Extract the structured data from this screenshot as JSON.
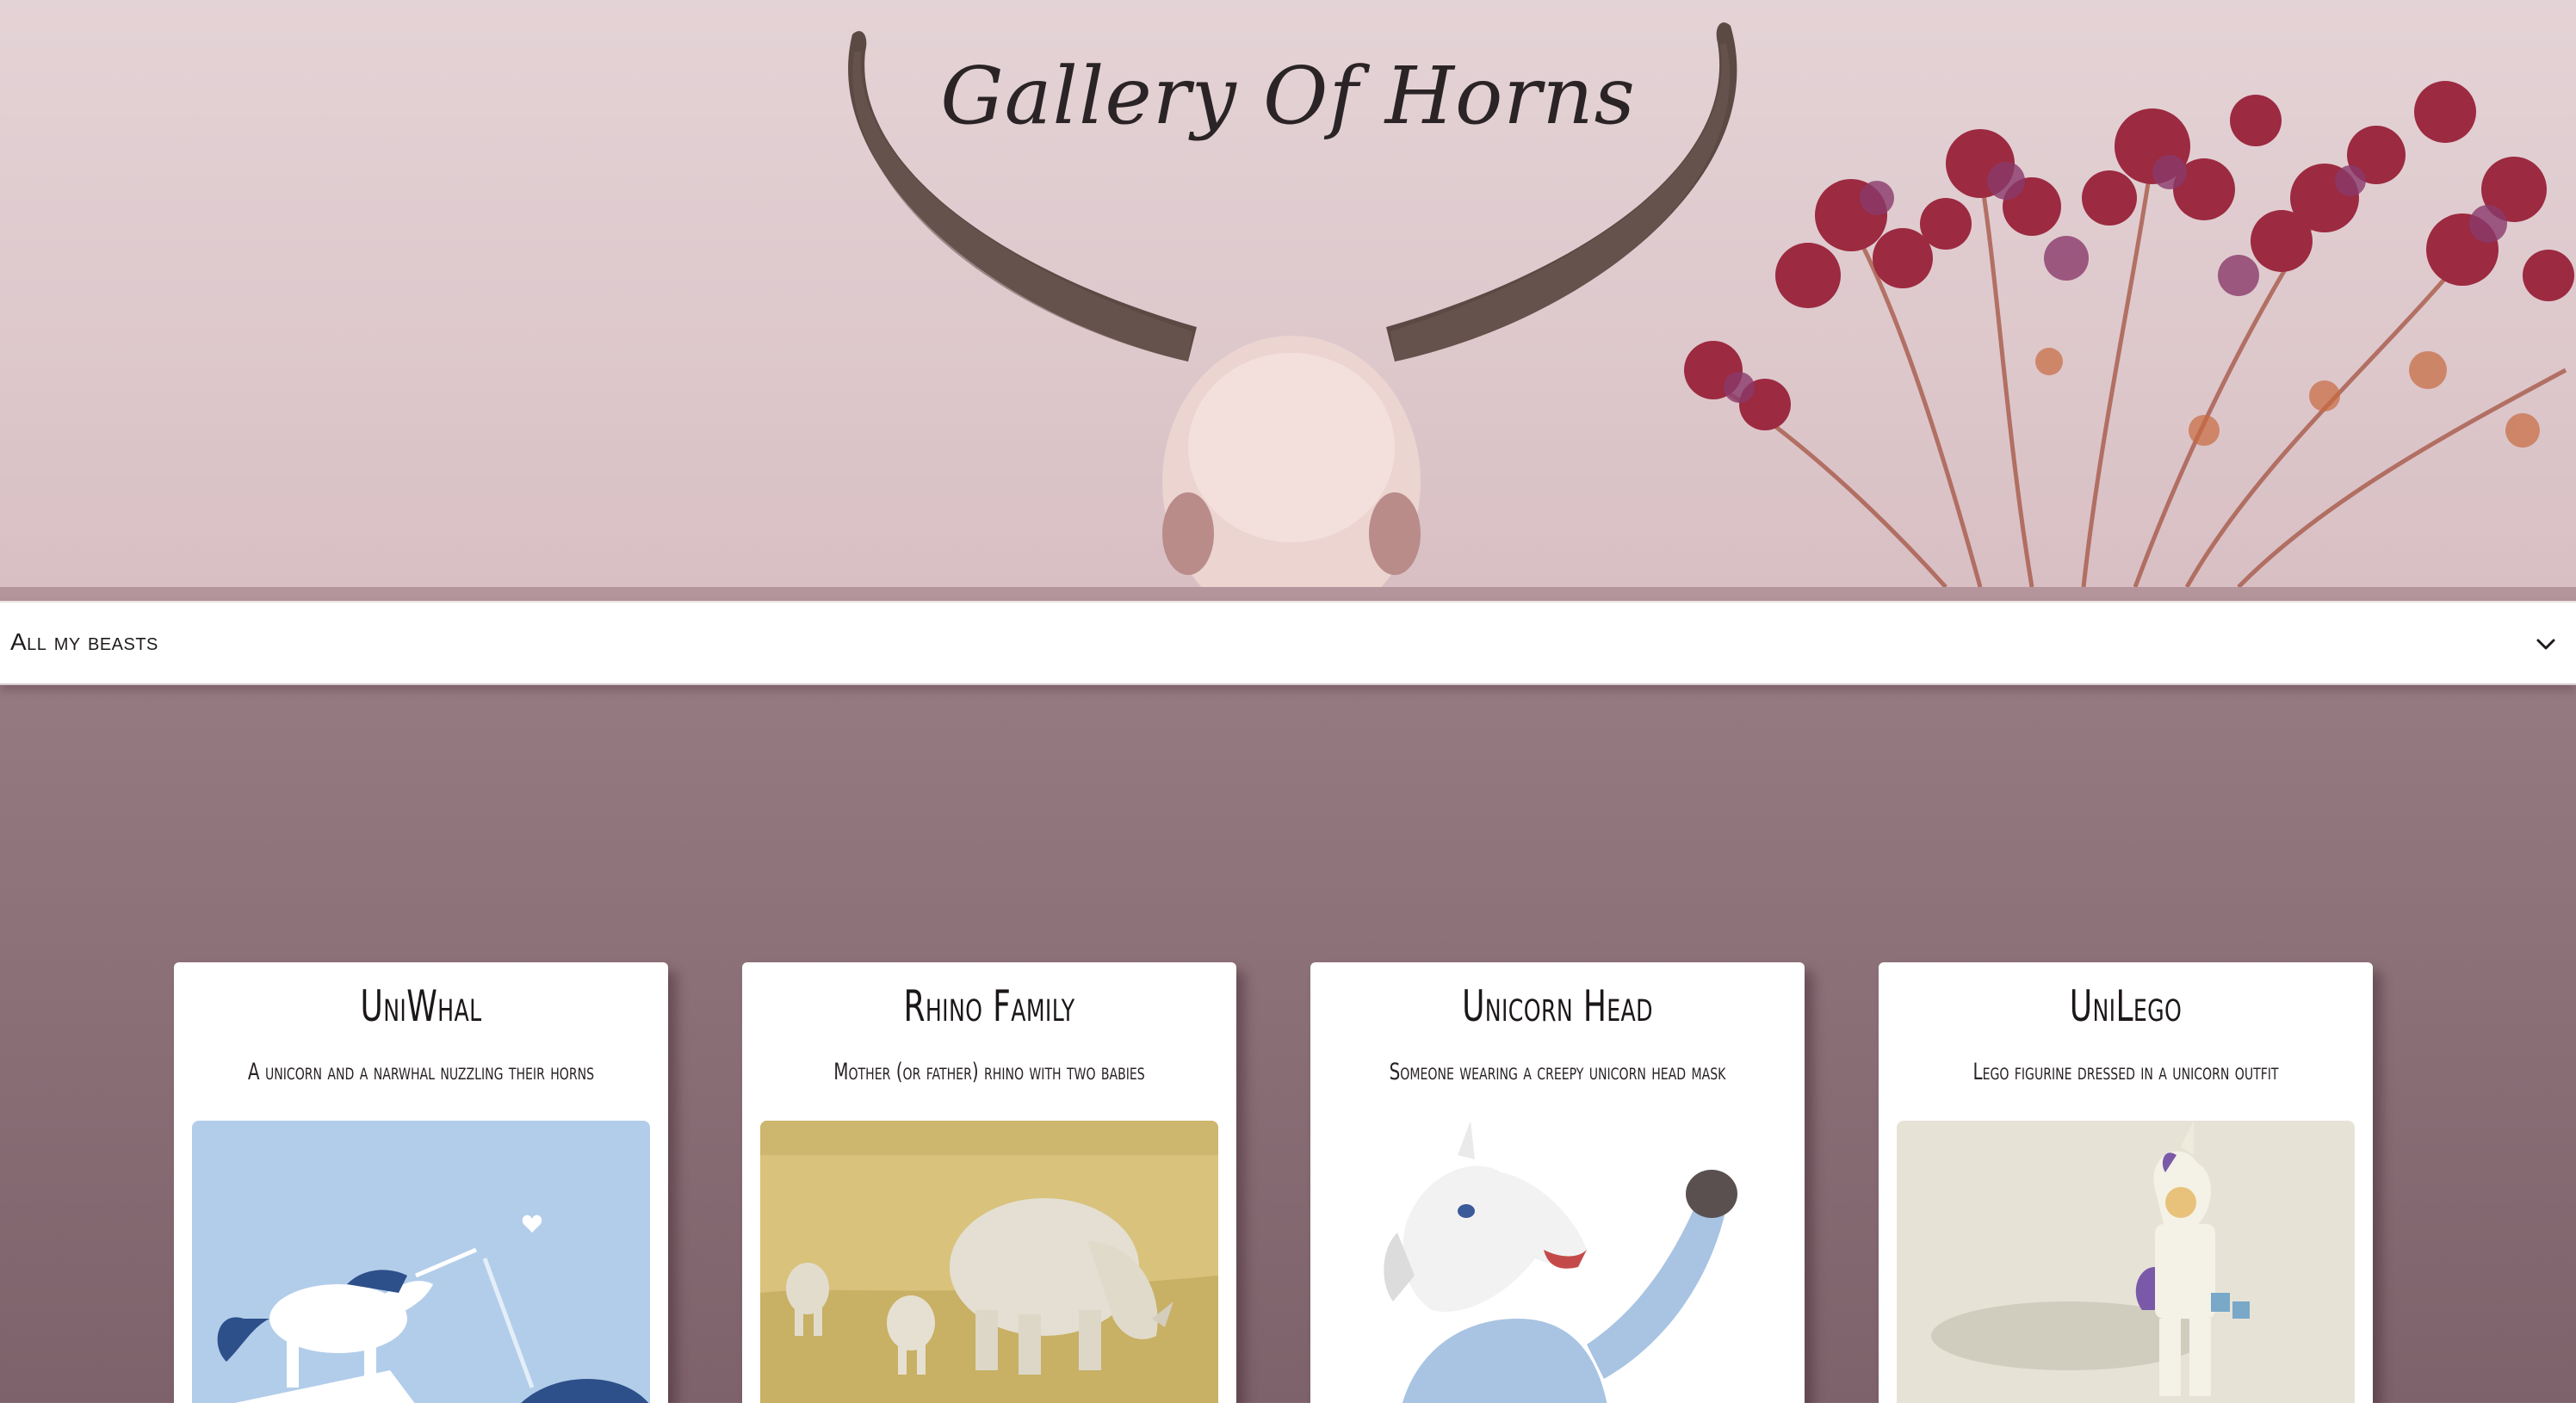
{
  "header": {
    "title": "Gallery Of Horns"
  },
  "filter": {
    "selected": "All my beasts"
  },
  "cards": [
    {
      "title": "UniWhal",
      "description": "A unicorn and a narwhal nuzzling their horns"
    },
    {
      "title": "Rhino Family",
      "description": "Mother (or father) rhino with two babies"
    },
    {
      "title": "Unicorn Head",
      "description": "Someone wearing a creepy unicorn head mask"
    },
    {
      "title": "UniLego",
      "description": "Lego figurine dressed in a unicorn outfit"
    }
  ],
  "colors": {
    "hero_bg": "#e4d3d6",
    "page_bg": "#9a7e85",
    "card_bg": "#ffffff"
  }
}
